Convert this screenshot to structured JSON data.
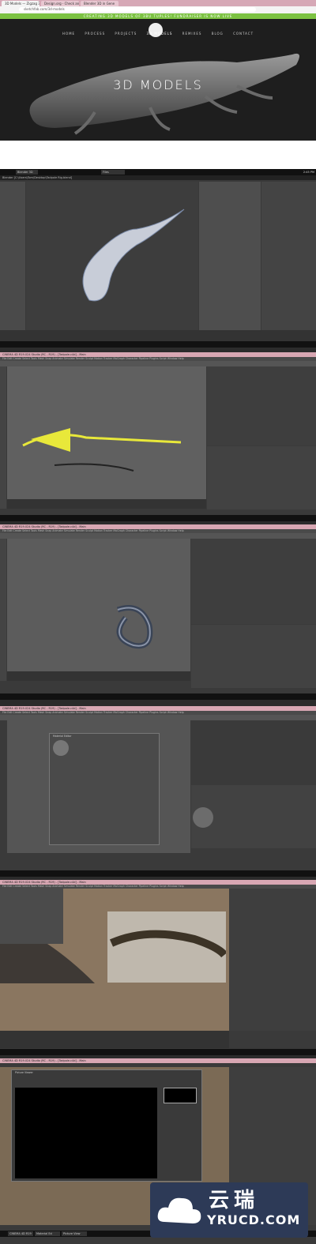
{
  "browser": {
    "tabs": [
      "3D Models — Zigzag 3D",
      "Design.org - Check and Mac",
      "Blender 3D in Gene"
    ],
    "url": "sketchfab.com/3d-models",
    "banner": "CREATING 3D MODELS OF 3BU TUPLES! FUNDRAISER IS NOW LIVE"
  },
  "site": {
    "nav": [
      "HOME",
      "PROCESS",
      "PROJECTS",
      "3D MODELS",
      "REMIXES",
      "BLOG",
      "CONTACT"
    ],
    "hero_title": "3D MODELS"
  },
  "apps": {
    "blender_title": "Blender [C:\\Users\\Tom\\Desktop\\Tadpole Rig.blend]",
    "c4d_title": "CINEMA 4D R19.024 Studio (RC - R19) - [Tadpole.c4d] - Main",
    "c4d_menu": "File  Edit  Create  Select  Tools  Mesh  Snap  Animate  Simulate  Render  Sculpt  Motion Tracker  MoGraph  Character  Pipeline  Plugins  Script  Window  Help",
    "material_editor": "Material Editor",
    "picture_viewer": "Picture Viewer"
  },
  "taskbars": {
    "time": "2:45 PM",
    "items": [
      "CINEMA 4D R19",
      "Material Ed",
      "Blender 3D",
      "Picture View",
      "Files"
    ]
  },
  "watermark": {
    "cn": "云瑞",
    "en": "YRUCD.COM"
  }
}
